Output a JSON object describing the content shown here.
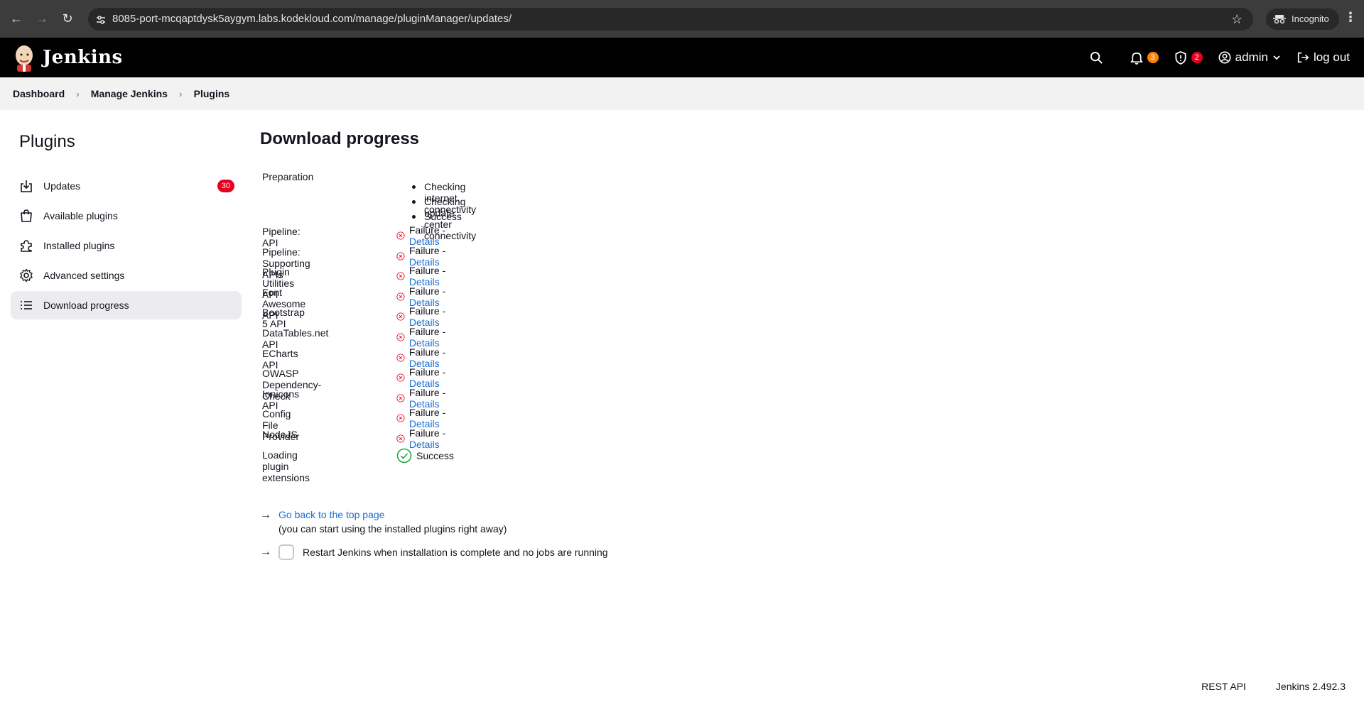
{
  "browser": {
    "url": "8085-port-mcqaptdysk5aygym.labs.kodekloud.com/manage/pluginManager/updates/",
    "incognito_label": "Incognito"
  },
  "header": {
    "app_name": "Jenkins",
    "notifications_count": "3",
    "security_count": "2",
    "user": "admin",
    "logout": "log out",
    "notif_color": "#fe820a",
    "security_color": "#e6001f"
  },
  "breadcrumb": [
    "Dashboard",
    "Manage Jenkins",
    "Plugins"
  ],
  "sidebar": {
    "title": "Plugins",
    "items": [
      {
        "label": "Updates",
        "icon": "download-icon",
        "badge": "30"
      },
      {
        "label": "Available plugins",
        "icon": "shopping-bag-icon"
      },
      {
        "label": "Installed plugins",
        "icon": "puzzle-icon"
      },
      {
        "label": "Advanced settings",
        "icon": "gear-icon"
      },
      {
        "label": "Download progress",
        "icon": "list-icon"
      }
    ]
  },
  "main": {
    "title": "Download progress",
    "preparation": {
      "label": "Preparation",
      "steps": [
        "Checking internet connectivity",
        "Checking update center connectivity",
        "Success"
      ]
    },
    "plugins": [
      {
        "name": "Pipeline: API",
        "status": "Failure",
        "link": "Details"
      },
      {
        "name": "Pipeline: Supporting APIs",
        "status": "Failure",
        "link": "Details"
      },
      {
        "name": "Plugin Utilities API",
        "status": "Failure",
        "link": "Details"
      },
      {
        "name": "Font Awesome API",
        "status": "Failure",
        "link": "Details"
      },
      {
        "name": "Bootstrap 5 API",
        "status": "Failure",
        "link": "Details"
      },
      {
        "name": "DataTables.net API",
        "status": "Failure",
        "link": "Details"
      },
      {
        "name": "ECharts API",
        "status": "Failure",
        "link": "Details"
      },
      {
        "name": "OWASP Dependency-Check",
        "status": "Failure",
        "link": "Details"
      },
      {
        "name": "Ionicons API",
        "status": "Failure",
        "link": "Details"
      },
      {
        "name": "Config File Provider",
        "status": "Failure",
        "link": "Details"
      },
      {
        "name": "NodeJS",
        "status": "Failure",
        "link": "Details"
      },
      {
        "name": "Loading plugin extensions",
        "status": "Success",
        "link": ""
      }
    ],
    "separator": " - ",
    "back_link": "Go back to the top page",
    "back_note": "(you can start using the installed plugins right away)",
    "restart_label": "Restart Jenkins when installation is complete and no jobs are running",
    "failure_color": "#e6001f",
    "success_color": "#1ea64b"
  },
  "footer": {
    "rest_api": "REST API",
    "version": "Jenkins 2.492.3"
  }
}
